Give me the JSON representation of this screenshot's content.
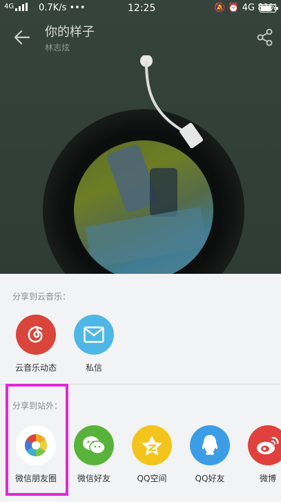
{
  "status_bar": {
    "network": "4G",
    "speed": "0.7K/s •••",
    "time": "12:25",
    "right_text": "🔕 ⏰ 4G 81%",
    "battery_percent": 81
  },
  "header": {
    "title": "你的样子",
    "artist": "林志炫"
  },
  "share_sheet": {
    "section_cloud_label": "分享到云音乐：",
    "cloud_items": [
      {
        "label": "云音乐动态",
        "color": "#d9453b",
        "icon": "netease-cloud-music-icon"
      },
      {
        "label": "私信",
        "color": "#4fb7e6",
        "icon": "envelope-icon"
      }
    ],
    "section_external_label": "分享到站外：",
    "external_items": [
      {
        "label": "微信朋友圈",
        "color": "#ffffff",
        "icon": "wechat-moments-icon"
      },
      {
        "label": "微信好友",
        "color": "#58b33a",
        "icon": "wechat-icon"
      },
      {
        "label": "QQ空间",
        "color": "#f3c51c",
        "icon": "qzone-icon"
      },
      {
        "label": "QQ好友",
        "color": "#3b9de6",
        "icon": "qq-icon"
      },
      {
        "label": "微博",
        "color": "#e0413c",
        "icon": "weibo-icon"
      }
    ]
  }
}
